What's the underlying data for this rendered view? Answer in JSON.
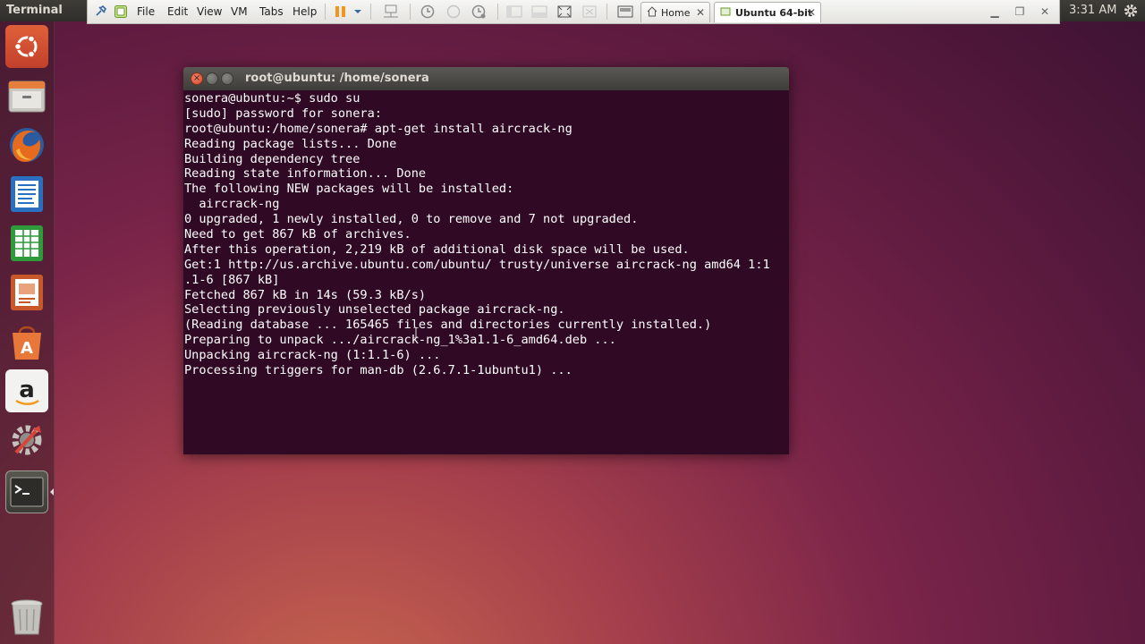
{
  "top_panel": {
    "app_name": "Terminal",
    "clock": "3:31 AM"
  },
  "vm_toolbar": {
    "menus": [
      "File",
      "Edit",
      "View",
      "VM",
      "Tabs",
      "Help"
    ],
    "tabs": [
      {
        "label": "Home",
        "active": false,
        "icon": "home-icon"
      },
      {
        "label": "Ubuntu 64-bit",
        "active": true,
        "icon": "vm-icon"
      }
    ]
  },
  "launcher": {
    "items": [
      {
        "name": "dash-home",
        "icon": "ubuntu-logo-icon"
      },
      {
        "name": "files",
        "icon": "file-manager-icon"
      },
      {
        "name": "firefox",
        "icon": "firefox-icon"
      },
      {
        "name": "writer",
        "icon": "libreoffice-writer-icon"
      },
      {
        "name": "calc",
        "icon": "libreoffice-calc-icon"
      },
      {
        "name": "impress",
        "icon": "libreoffice-impress-icon"
      },
      {
        "name": "software-center",
        "icon": "software-center-icon"
      },
      {
        "name": "amazon",
        "icon": "amazon-icon"
      },
      {
        "name": "system-settings",
        "icon": "system-settings-icon"
      },
      {
        "name": "terminal",
        "icon": "terminal-icon"
      },
      {
        "name": "trash",
        "icon": "trash-icon"
      }
    ]
  },
  "terminal": {
    "title": "root@ubuntu: /home/sonera",
    "lines": [
      "sonera@ubuntu:~$ sudo su",
      "[sudo] password for sonera:",
      "root@ubuntu:/home/sonera# apt-get install aircrack-ng",
      "Reading package lists... Done",
      "Building dependency tree",
      "Reading state information... Done",
      "The following NEW packages will be installed:",
      "  aircrack-ng",
      "0 upgraded, 1 newly installed, 0 to remove and 7 not upgraded.",
      "Need to get 867 kB of archives.",
      "After this operation, 2,219 kB of additional disk space will be used.",
      "Get:1 http://us.archive.ubuntu.com/ubuntu/ trusty/universe aircrack-ng amd64 1:1",
      ".1-6 [867 kB]",
      "Fetched 867 kB in 14s (59.3 kB/s)",
      "Selecting previously unselected package aircrack-ng.",
      "(Reading database ... 165465 files and directories currently installed.)",
      "Preparing to unpack .../aircrack-ng_1%3a1.1-6_amd64.deb ...",
      "Unpacking aircrack-ng (1:1.1-6) ...",
      "Processing triggers for man-db (2.6.7.1-1ubuntu1) ..."
    ]
  },
  "colors": {
    "terminal_bg": "#300a24",
    "terminal_fg": "#ffffff",
    "panel_bg": "#3c3b37",
    "close_button": "#e0593a"
  }
}
